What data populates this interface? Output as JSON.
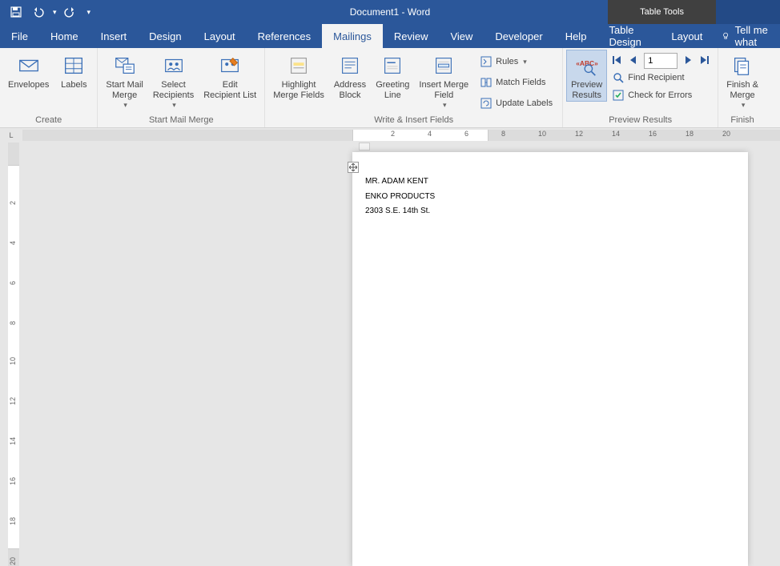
{
  "titlebar": {
    "doc_title": "Document1  -  Word",
    "table_tools": "Table Tools"
  },
  "tabs": {
    "file": "File",
    "home": "Home",
    "insert": "Insert",
    "design": "Design",
    "layout": "Layout",
    "references": "References",
    "mailings": "Mailings",
    "review": "Review",
    "view": "View",
    "developer": "Developer",
    "help": "Help",
    "table_design": "Table Design",
    "table_layout": "Layout",
    "tellme": "Tell me what"
  },
  "ribbon": {
    "create": {
      "envelopes": "Envelopes",
      "labels": "Labels",
      "group": "Create"
    },
    "startmm": {
      "start": "Start Mail\nMerge",
      "select": "Select\nRecipients",
      "edit": "Edit\nRecipient List",
      "group": "Start Mail Merge"
    },
    "fields": {
      "highlight": "Highlight\nMerge Fields",
      "address": "Address\nBlock",
      "greeting": "Greeting\nLine",
      "insert": "Insert Merge\nField",
      "rules": "Rules",
      "match": "Match Fields",
      "update": "Update Labels",
      "group": "Write & Insert Fields"
    },
    "preview": {
      "preview": "Preview\nResults",
      "record": "1",
      "find": "Find Recipient",
      "check": "Check for Errors",
      "group": "Preview Results"
    },
    "finish": {
      "finish": "Finish &\nMerge",
      "group": "Finish"
    }
  },
  "ruler": {
    "corner": "L",
    "h": [
      "2",
      "4",
      "6",
      "8",
      "10",
      "12",
      "14",
      "16",
      "18",
      "20"
    ],
    "v": [
      "2",
      "4",
      "6",
      "8",
      "10",
      "12",
      "14",
      "16",
      "18",
      "20"
    ]
  },
  "document": {
    "line1": "MR. ADAM KENT",
    "line2": "ENKO PRODUCTS",
    "line3": "2303 S.E. 14th St."
  }
}
